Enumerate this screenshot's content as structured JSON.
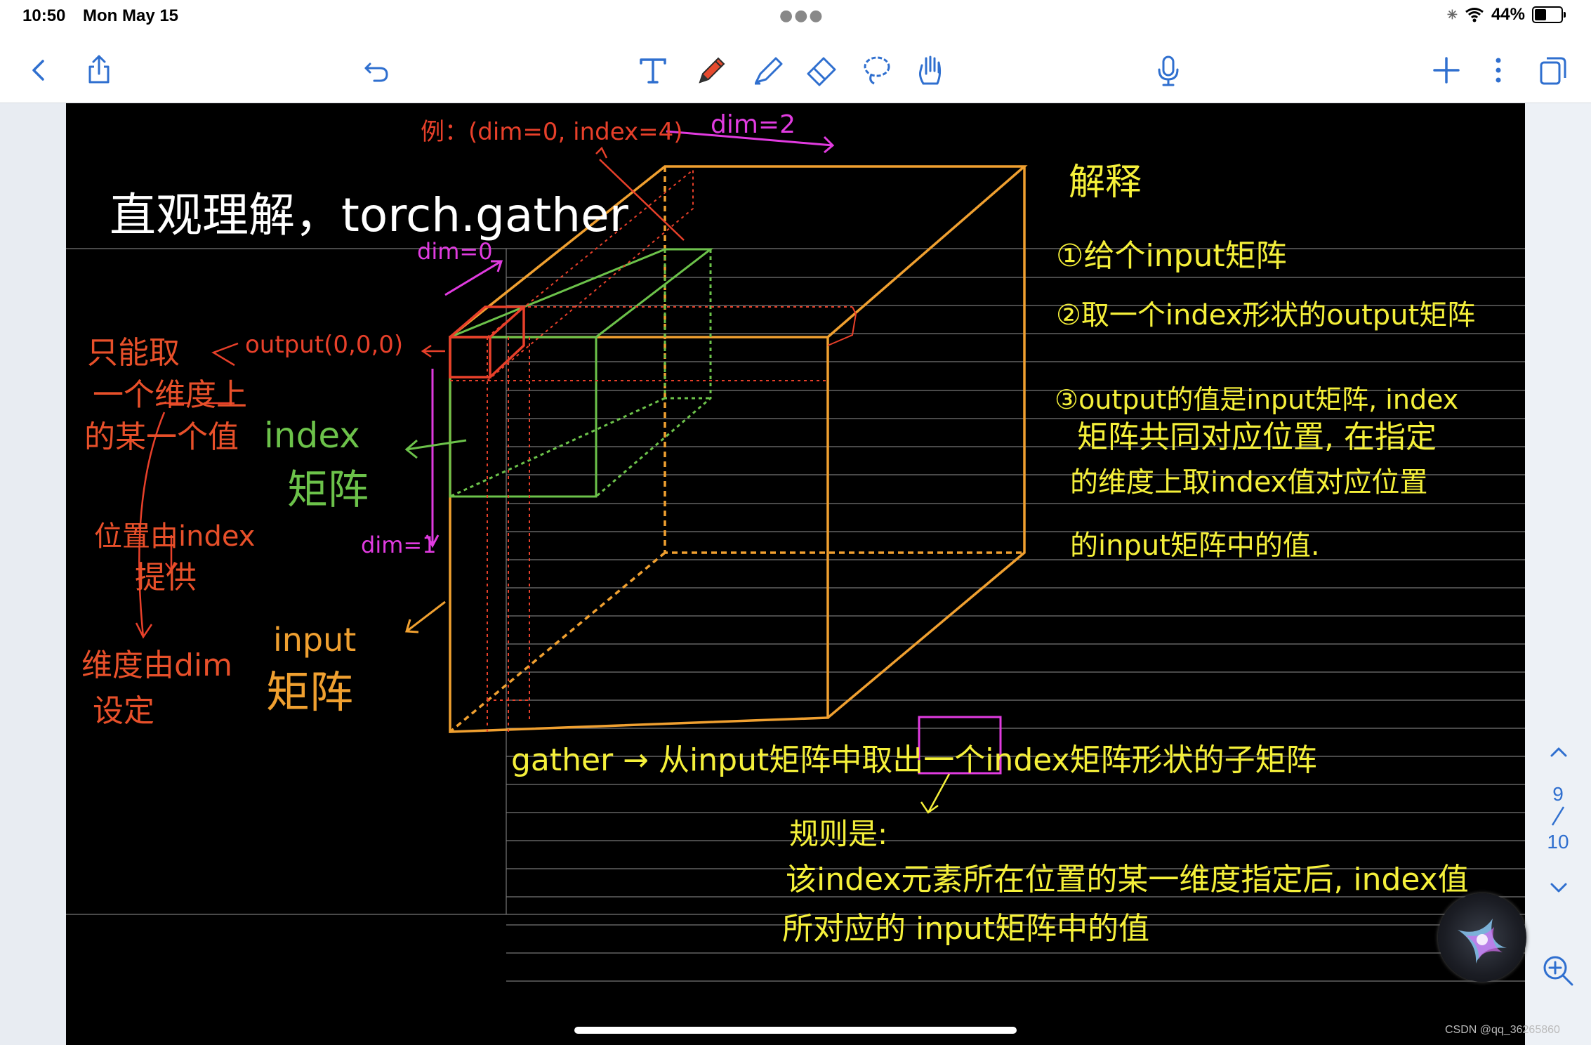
{
  "status_bar": {
    "time": "10:50",
    "date": "Mon May 15",
    "battery": "44%",
    "battery_level": 0.44
  },
  "toolbar": {
    "left": [
      "back-icon",
      "share-icon",
      "undo-icon"
    ],
    "center": [
      "text-tool-icon",
      "pen-tool-icon",
      "highlighter-tool-icon",
      "eraser-tool-icon",
      "lasso-tool-icon",
      "hand-tool-icon",
      "microphone-icon"
    ],
    "right": [
      "add-icon",
      "more-icon",
      "pages-icon"
    ],
    "accent": "#2f6fcf"
  },
  "note": {
    "title": "直观理解，torch.gather",
    "example": "例：(dim=0, index=4)",
    "dim_labels": {
      "dim2": "dim=2",
      "dim0": "dim=0",
      "dim1": "dim=1"
    },
    "output_label": "output(0,0,0)",
    "left_notes": {
      "line1": "只能取",
      "line2": "一个维度上",
      "line3": "的某一个值",
      "line4": "位置由index",
      "line5": "提供",
      "line6": "维度由dim",
      "line7": "设定"
    },
    "index_label": {
      "en": "index",
      "cn": "矩阵"
    },
    "input_label": {
      "en": "input",
      "cn": "矩阵"
    },
    "explain": {
      "heading": "解释",
      "p1": "①给个input矩阵",
      "p2": "②取一个index形状的output矩阵",
      "p3a": "③output的值是input矩阵, index",
      "p3b": "矩阵共同对应位置, 在指定",
      "p3c": "的维度上取index值对应位置",
      "p3d": "的input矩阵中的值."
    },
    "gather": {
      "line": "gather → 从input矩阵中取出一个index矩阵形状的子矩阵",
      "rule": "规则是:",
      "rule1": "该index元素所在位置的某一维度指定后, index值",
      "rule2": "所对应的 input矩阵中的值"
    },
    "colors": {
      "orange": "#f0a030",
      "green": "#6cc24a",
      "red": "#e8402a",
      "magenta": "#e13be0",
      "yellow": "#f5f03a",
      "white": "#ffffff",
      "redtext": "#e8502a"
    }
  },
  "page_indicator": {
    "current": "9",
    "total": "10"
  },
  "watermark": "CSDN @qq_36265860"
}
